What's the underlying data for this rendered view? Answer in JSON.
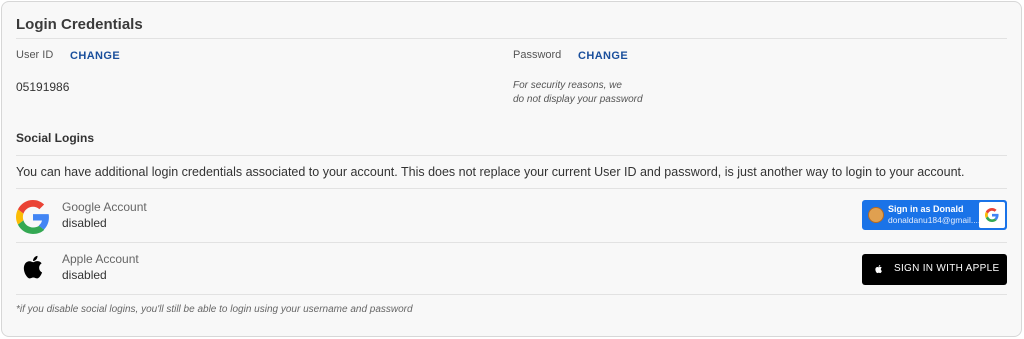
{
  "credentials": {
    "title": "Login Credentials",
    "user_id_label": "User ID",
    "user_id_change": "CHANGE",
    "user_id_value": "05191986",
    "password_label": "Password",
    "password_change": "CHANGE",
    "password_note_line1": "For security reasons, we",
    "password_note_line2": "do not display your password"
  },
  "social": {
    "title": "Social Logins",
    "description": "You can have additional login credentials associated to your account. This does not replace your current User ID and password, is just another way to login to your account.",
    "google": {
      "name": "Google Account",
      "status": "disabled",
      "button_title": "Sign in as Donald",
      "button_email": "donaldanu184@gmail....",
      "icon": "google-g-icon"
    },
    "apple": {
      "name": "Apple Account",
      "status": "disabled",
      "button_label": "SIGN IN WITH APPLE",
      "icon": "apple-icon"
    },
    "footnote": "*if you disable social logins, you'll still be able to login using your username and password"
  },
  "colors": {
    "link": "#1a4f9c",
    "google_blue": "#1a73e8",
    "apple_black": "#000000"
  }
}
